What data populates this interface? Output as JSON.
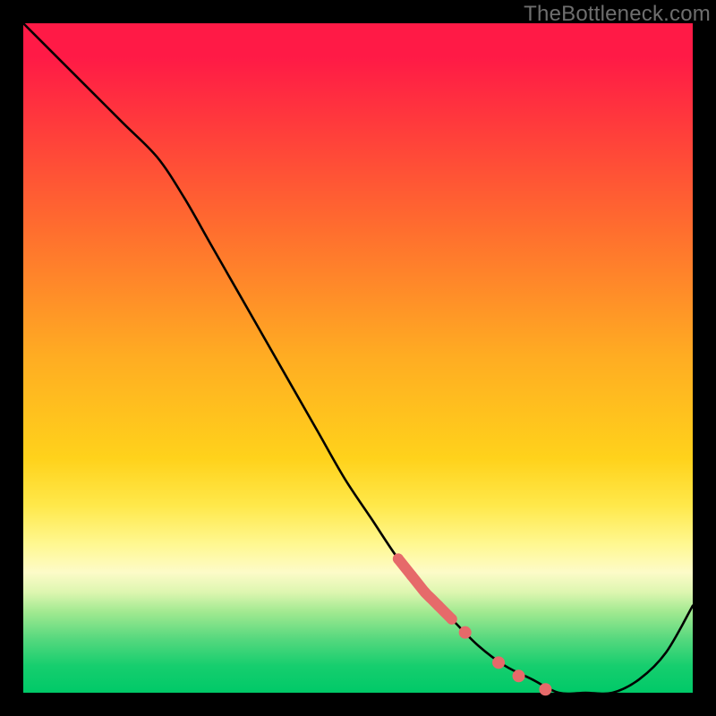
{
  "watermark": {
    "text": "TheBottleneck.com"
  },
  "chart_data": {
    "type": "line",
    "title": "",
    "xlabel": "",
    "ylabel": "",
    "xlim": [
      0,
      100
    ],
    "ylim": [
      0,
      100
    ],
    "series": [
      {
        "name": "bottleneck-curve",
        "x": [
          0,
          5,
          10,
          15,
          20,
          24,
          28,
          32,
          36,
          40,
          44,
          48,
          52,
          56,
          60,
          64,
          68,
          72,
          76,
          80,
          84,
          88,
          92,
          96,
          100
        ],
        "y": [
          100,
          95,
          90,
          85,
          80,
          74,
          67,
          60,
          53,
          46,
          39,
          32,
          26,
          20,
          15,
          11,
          7,
          4,
          2,
          0,
          0,
          0,
          2,
          6,
          13
        ]
      }
    ],
    "highlight_points": {
      "name": "selected-range",
      "color": "#e66a6a",
      "x": [
        56,
        58,
        60,
        62,
        64,
        66,
        71,
        74,
        78
      ],
      "y": [
        20,
        17.5,
        15,
        13,
        11,
        9,
        4.5,
        2.5,
        0.5
      ]
    }
  }
}
